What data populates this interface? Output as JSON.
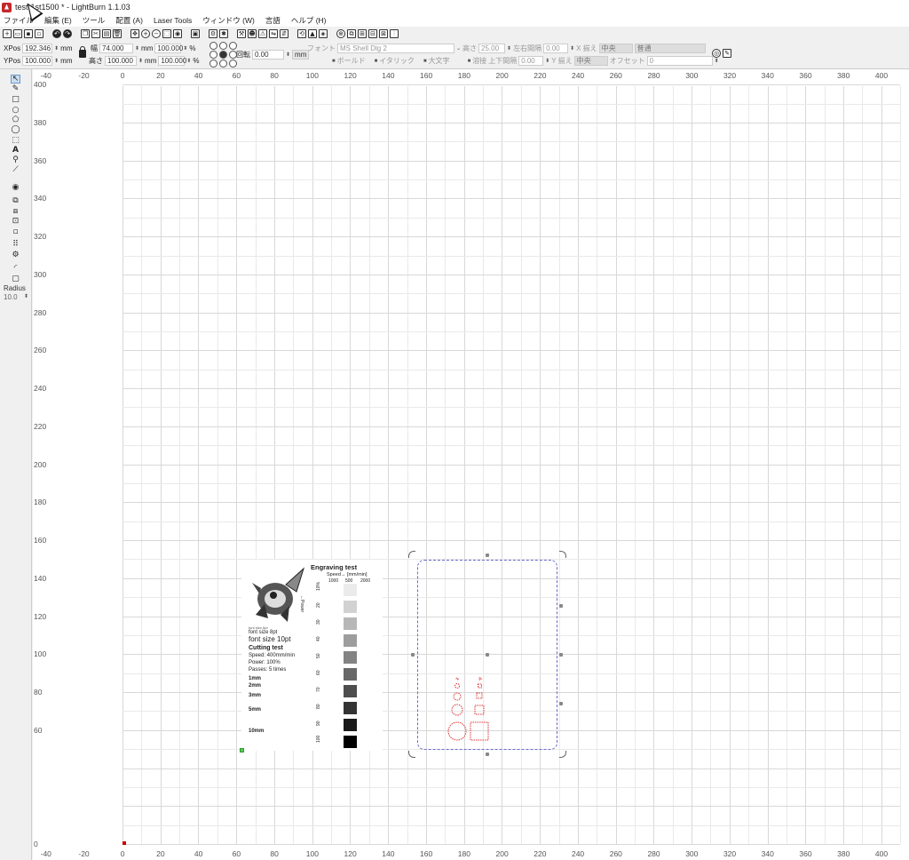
{
  "window": {
    "title": "test-1st1500 * - LightBurn 1.1.03"
  },
  "menu": [
    "ファイル",
    "編集 (E)",
    "ツール",
    "配置 (A)",
    "Laser Tools",
    "ウィンドウ (W)",
    "言語",
    "ヘルプ (H)"
  ],
  "numeric_edits": {
    "xpos_label": "XPos",
    "xpos_value": "192.346",
    "xpos_unit": "mm",
    "ypos_label": "YPos",
    "ypos_value": "100.000",
    "ypos_unit": "mm",
    "width_label": "幅",
    "width_value": "74.000",
    "width_unit": "mm",
    "height_label": "高さ",
    "height_value": "100.000",
    "height_unit": "mm",
    "scale_x": "100.000",
    "scale_y": "100.000",
    "percent": "%",
    "rotate_label": "回転",
    "rotate_value": "0.00",
    "mm_button": "mm"
  },
  "text_options": {
    "font_label": "フォント",
    "font_value": "MS Shell Dlg 2",
    "height_label": "高さ",
    "height_value": "25.00",
    "hspace_label": "左右間隔",
    "hspace_value": "0.00",
    "xalign_label": "X 揃え",
    "xalign_value": "中央",
    "style_value": "普通",
    "bold_label": "ボールド",
    "italic_label": "イタリック",
    "upper_label": "大文字",
    "weld_label": "溶接",
    "vspace_label": "上下間隔",
    "vspace_value": "0.00",
    "yalign_label": "Y 揃え",
    "yalign_value": "中央",
    "offset_label": "オフセット",
    "offset_value": "0"
  },
  "left_tools": {
    "radius_label": "Radius",
    "radius_value": "10.0"
  },
  "ruler": {
    "x_labels": [
      "-40",
      "-20",
      "0",
      "20",
      "40",
      "60",
      "80",
      "100",
      "120",
      "140",
      "160",
      "180",
      "200",
      "220",
      "240",
      "260",
      "280",
      "300",
      "320",
      "340",
      "360",
      "380",
      "400"
    ],
    "y_labels": [
      "400",
      "380",
      "360",
      "340",
      "320",
      "300",
      "280",
      "260",
      "240",
      "220",
      "200",
      "180",
      "160",
      "140",
      "120",
      "100",
      "80",
      "60",
      "0"
    ]
  },
  "test_card": {
    "small_label": "font size 6pt",
    "font_small": "font size 8pt",
    "font_large": "font size 10pt",
    "cutting_title": "Cutting test",
    "speed": "Speed: 400mm/min",
    "power": "Power: 100%",
    "passes": "Passes: 5 times",
    "sizes": [
      "1mm",
      "2mm",
      "3mm",
      "5mm",
      "10mm"
    ],
    "engraving_title": "Engraving test",
    "speed_axis": "Speed→ [mm/min]",
    "speed_cols": [
      "1000",
      "500",
      "2000"
    ],
    "power_axis": "←Power",
    "power_rows": [
      "10%",
      "20",
      "30",
      "40",
      "50",
      "60",
      "70",
      "80",
      "90",
      "100"
    ]
  }
}
